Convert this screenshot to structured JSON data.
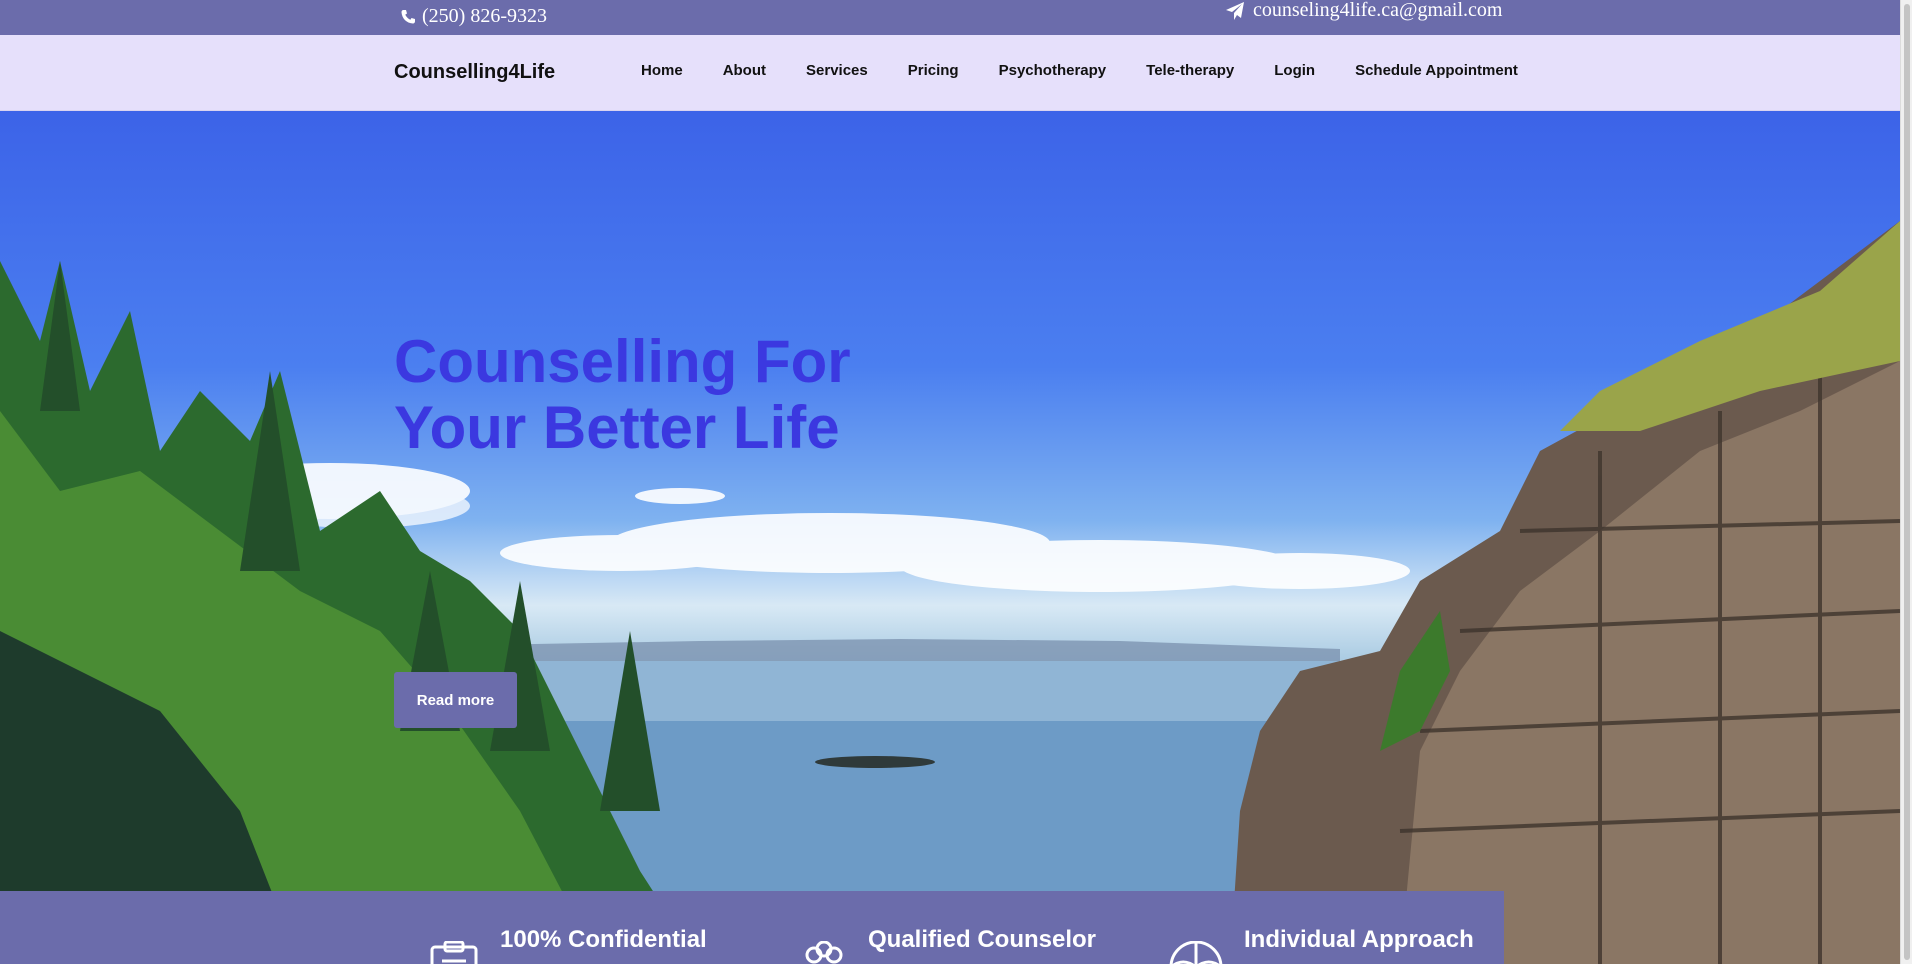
{
  "topbar": {
    "phone": "(250) 826-9323",
    "email": "counseling4life.ca@gmail.com",
    "phone_icon": "phone-icon",
    "email_icon": "paper-plane-icon"
  },
  "navbar": {
    "brand": "Counselling4Life",
    "items": [
      {
        "label": "Home"
      },
      {
        "label": "About"
      },
      {
        "label": "Services"
      },
      {
        "label": "Pricing"
      },
      {
        "label": "Psychotherapy"
      },
      {
        "label": "Tele-therapy"
      },
      {
        "label": "Login"
      },
      {
        "label": "Schedule Appointment"
      }
    ]
  },
  "hero": {
    "title_line1": "Counselling For",
    "title_line2": "Your Better Life",
    "read_more": "Read more"
  },
  "features": [
    {
      "title": "100% Confidential",
      "icon": "clipboard-icon"
    },
    {
      "title": "Qualified Counselor",
      "icon": "people-icon"
    },
    {
      "title": "Individual Approach",
      "icon": "umbrella-icon"
    }
  ],
  "colors": {
    "topbar": "#6b6cab",
    "navbar": "#e6e0fb",
    "hero_title": "#3b38e0",
    "button": "#6b6cab"
  }
}
